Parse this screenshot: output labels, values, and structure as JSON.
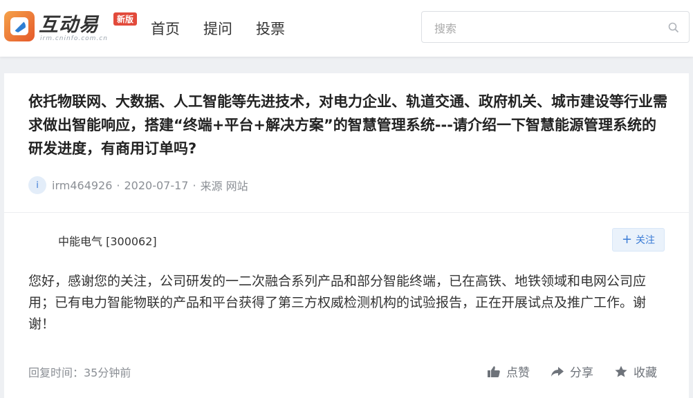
{
  "header": {
    "logo_text": "互动易",
    "logo_badge": "新版",
    "logo_url": "irm.cninfo.com.cn",
    "nav": [
      "首页",
      "提问",
      "投票"
    ],
    "search_placeholder": "搜索",
    "search_icon": "search-icon"
  },
  "question": {
    "text": "依托物联网、大数据、人工智能等先进技术，对电力企业、轨道交通、政府机关、城市建设等行业需求做出智能响应，搭建“终端+平台+解决方案”的智慧管理系统---请介绍一下智慧能源管理系统的研发进度，有商用订单吗?",
    "avatar_letter": "i",
    "user": "irm464926",
    "date": "2020-07-17",
    "source_label": "来源",
    "source": "网站"
  },
  "answer": {
    "company": "中能电气 [300062]",
    "follow_label": "关注",
    "text": "您好，感谢您的关注，公司研发的一二次融合系列产品和部分智能终端，已在高铁、地铁领域和电网公司应用；已有电力智能物联的产品和平台获得了第三方权威检测机构的试验报告，正在开展试点及推广工作。谢谢！",
    "reply_time": "回复时间：35分钟前",
    "actions": {
      "like": "点赞",
      "share": "分享",
      "collect": "收藏"
    }
  },
  "colors": {
    "accent": "#3a7bd5",
    "badge": "#e24a3b",
    "background": "#eef0f3"
  }
}
